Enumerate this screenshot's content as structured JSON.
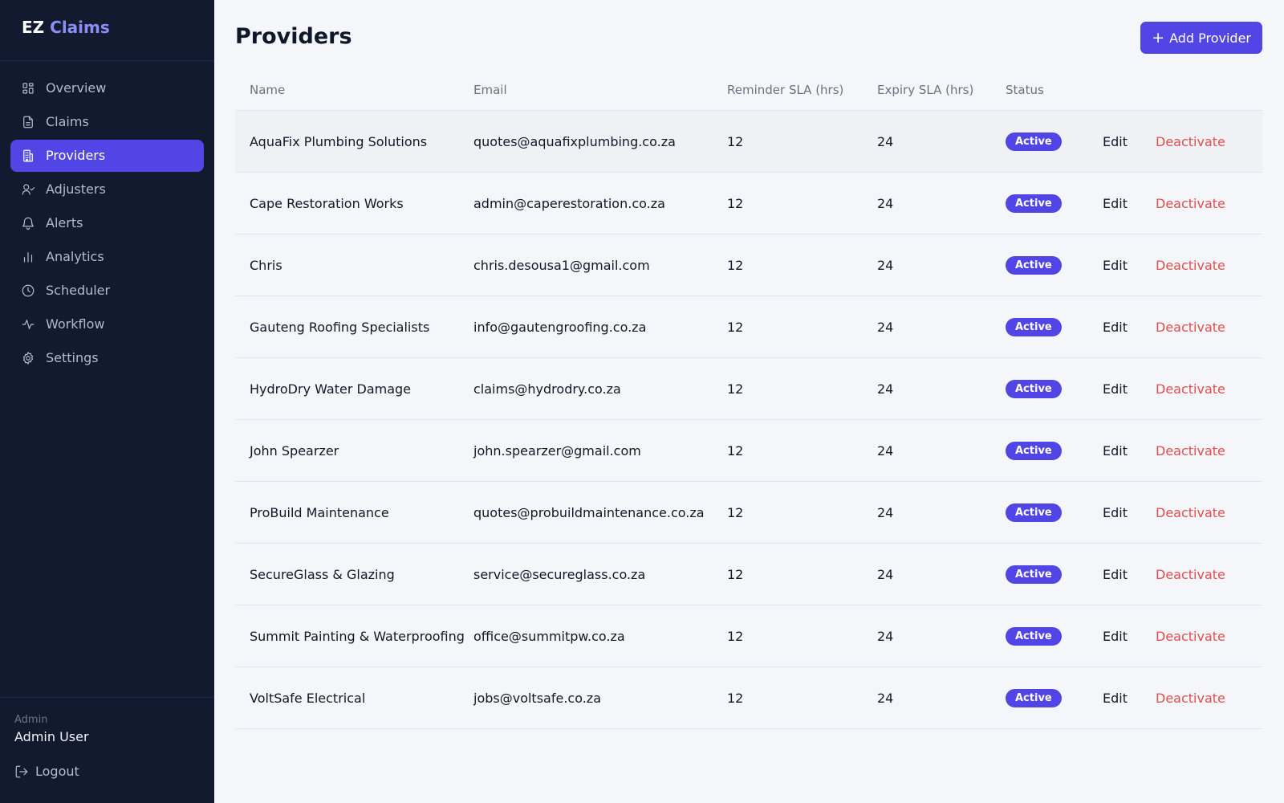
{
  "brand": {
    "prefix": "EZ",
    "accent": "Claims"
  },
  "sidebar": {
    "items": [
      {
        "label": "Overview",
        "icon": "grid-icon"
      },
      {
        "label": "Claims",
        "icon": "document-icon"
      },
      {
        "label": "Providers",
        "icon": "building-icon",
        "active": true
      },
      {
        "label": "Adjusters",
        "icon": "user-check-icon"
      },
      {
        "label": "Alerts",
        "icon": "bell-icon"
      },
      {
        "label": "Analytics",
        "icon": "bar-chart-icon"
      },
      {
        "label": "Scheduler",
        "icon": "clock-icon"
      },
      {
        "label": "Workflow",
        "icon": "activity-icon"
      },
      {
        "label": "Settings",
        "icon": "gear-icon"
      }
    ],
    "footer": {
      "role": "Admin",
      "user": "Admin User",
      "logout": "Logout"
    }
  },
  "page": {
    "title": "Providers",
    "add_button": "Add Provider"
  },
  "table": {
    "headers": {
      "name": "Name",
      "email": "Email",
      "reminder": "Reminder SLA (hrs)",
      "expiry": "Expiry SLA (hrs)",
      "status": "Status"
    },
    "action_edit": "Edit",
    "action_deactivate": "Deactivate",
    "rows": [
      {
        "name": "AquaFix Plumbing Solutions",
        "email": "quotes@aquafixplumbing.co.za",
        "reminder": "12",
        "expiry": "24",
        "status": "Active"
      },
      {
        "name": "Cape Restoration Works",
        "email": "admin@caperestoration.co.za",
        "reminder": "12",
        "expiry": "24",
        "status": "Active"
      },
      {
        "name": "Chris",
        "email": "chris.desousa1@gmail.com",
        "reminder": "12",
        "expiry": "24",
        "status": "Active"
      },
      {
        "name": "Gauteng Roofing Specialists",
        "email": "info@gautengroofing.co.za",
        "reminder": "12",
        "expiry": "24",
        "status": "Active"
      },
      {
        "name": "HydroDry Water Damage",
        "email": "claims@hydrodry.co.za",
        "reminder": "12",
        "expiry": "24",
        "status": "Active"
      },
      {
        "name": "John Spearzer",
        "email": "john.spearzer@gmail.com",
        "reminder": "12",
        "expiry": "24",
        "status": "Active"
      },
      {
        "name": "ProBuild Maintenance",
        "email": "quotes@probuildmaintenance.co.za",
        "reminder": "12",
        "expiry": "24",
        "status": "Active"
      },
      {
        "name": "SecureGlass & Glazing",
        "email": "service@secureglass.co.za",
        "reminder": "12",
        "expiry": "24",
        "status": "Active"
      },
      {
        "name": "Summit Painting & Waterproofing",
        "email": "office@summitpw.co.za",
        "reminder": "12",
        "expiry": "24",
        "status": "Active"
      },
      {
        "name": "VoltSafe Electrical",
        "email": "jobs@voltsafe.co.za",
        "reminder": "12",
        "expiry": "24",
        "status": "Active"
      }
    ]
  },
  "colors": {
    "sidebar_bg": "#111a2e",
    "accent": "#5146e5",
    "danger": "#e04e4e",
    "page_bg": "#f4f6f9"
  }
}
